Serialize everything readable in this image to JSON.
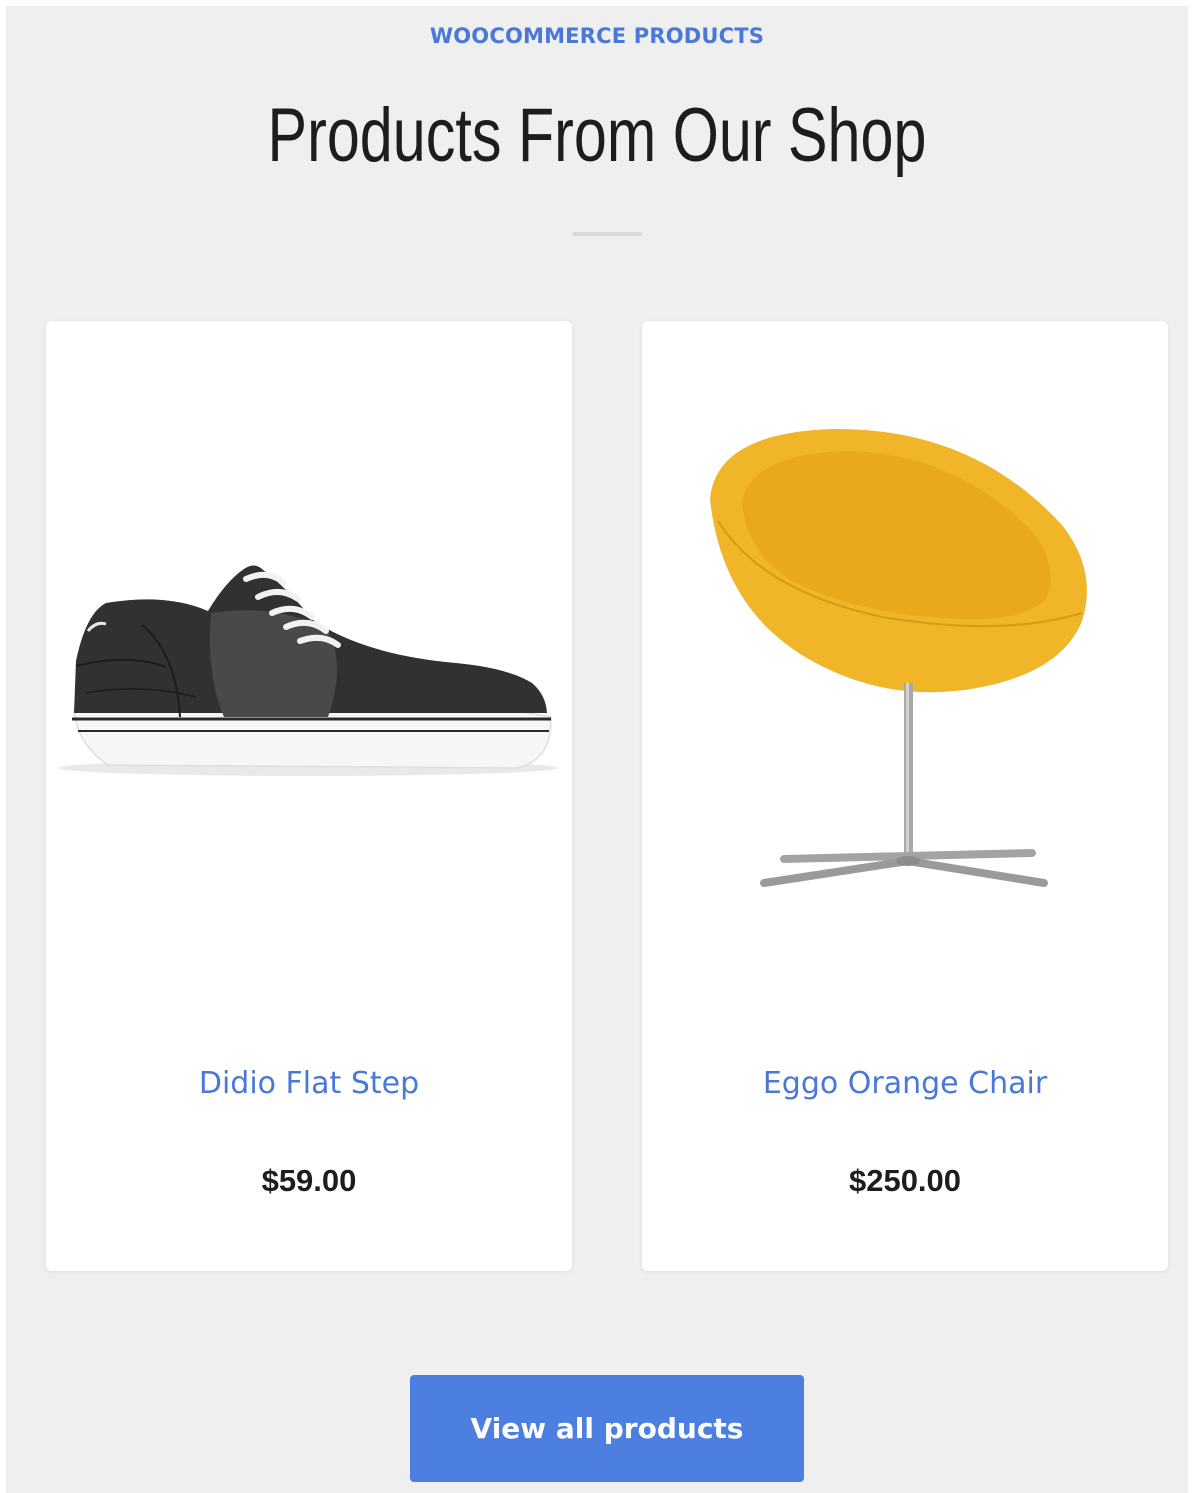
{
  "section": {
    "eyebrow": "WOOCOMMERCE PRODUCTS",
    "title": "Products From Our Shop"
  },
  "products": [
    {
      "name": "Didio Flat Step",
      "price": "$59.00",
      "image_icon": "sneaker-image"
    },
    {
      "name": "Eggo Orange Chair",
      "price": "$250.00",
      "image_icon": "orange-chair-image"
    }
  ],
  "actions": {
    "view_all_label": "View all products"
  },
  "colors": {
    "accent": "#4a78d6",
    "button": "#4d7fe0",
    "background": "#efefef",
    "card": "#ffffff",
    "heading": "#1d1d1d"
  }
}
